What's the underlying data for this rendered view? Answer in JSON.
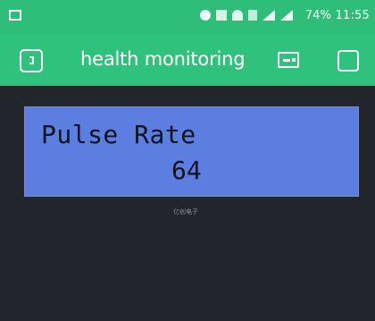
{
  "status_bar": {
    "time_and_battery": "74% 11:55",
    "colors": {
      "background": "#2fbe79"
    }
  },
  "app_bar": {
    "title": "health monitoring",
    "icons": [
      "back-icon",
      "device-icon",
      "square-icon"
    ],
    "colors": {
      "background": "#2ec27d",
      "foreground": "#ffffff"
    }
  },
  "widget": {
    "label": "Pulse Rate",
    "value": "64",
    "colors": {
      "background": "#5b7ee0",
      "text": "#121418"
    }
  },
  "watermark": "亿创电子"
}
